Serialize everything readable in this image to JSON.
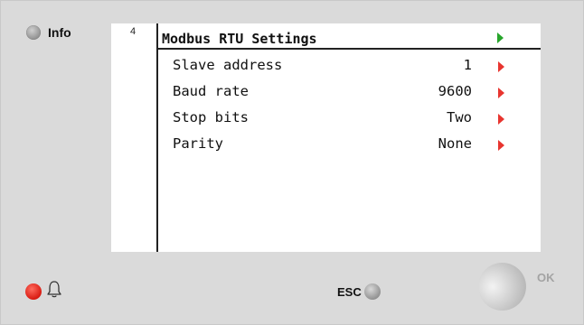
{
  "info_button": {
    "label": "Info"
  },
  "screen": {
    "page_number": "4",
    "title": "Modbus RTU Settings",
    "rows": [
      {
        "label": "Slave address",
        "value": "1"
      },
      {
        "label": "Baud rate",
        "value": "9600"
      },
      {
        "label": "Stop bits",
        "value": "Two"
      },
      {
        "label": "Parity",
        "value": "None"
      }
    ]
  },
  "esc_button": {
    "label": "ESC"
  },
  "ok_button": {
    "label": "OK"
  },
  "colors": {
    "panel": "#dadada",
    "screen": "#ffffff",
    "alarm_led": "#e0241a",
    "title_arrow": "#27a52b",
    "row_arrow": "#e8352f"
  },
  "icons": [
    "info-led",
    "alarm-led",
    "bell-icon",
    "esc-led",
    "ok-knob",
    "play-arrow-icon"
  ]
}
